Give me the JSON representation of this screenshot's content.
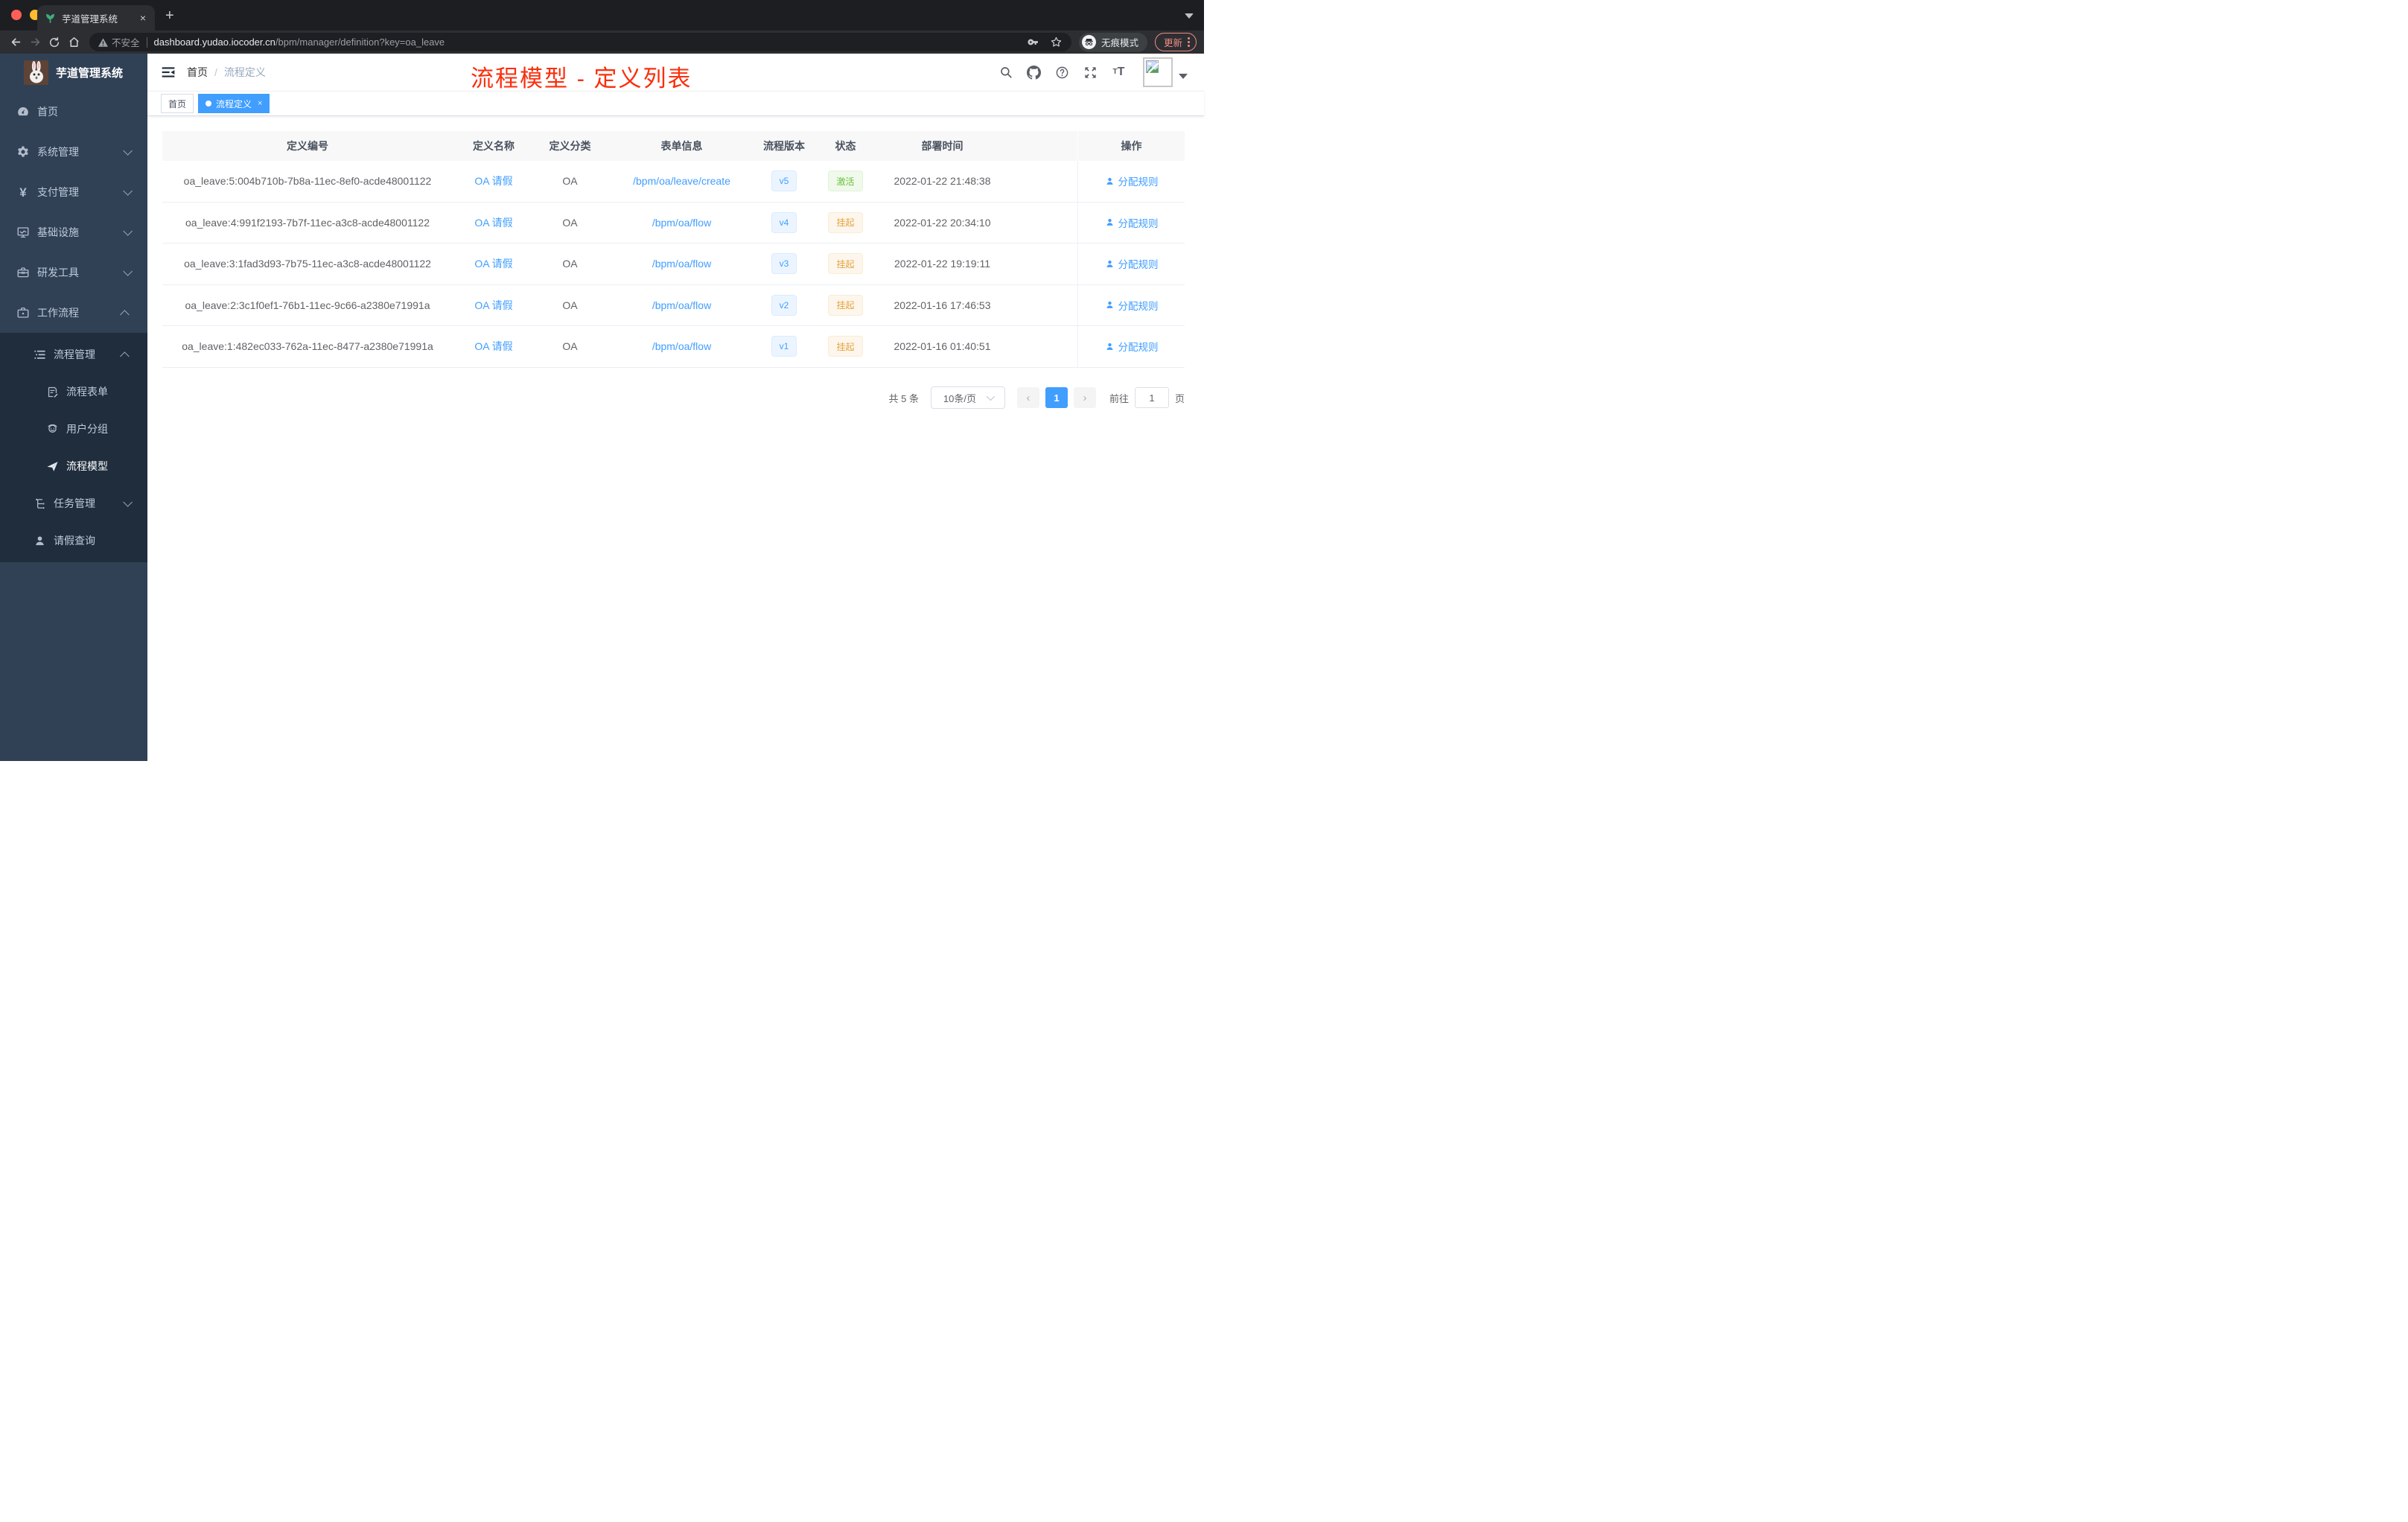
{
  "browser": {
    "tab_title": "芋道管理系统",
    "tab_close": "×",
    "new_tab": "+",
    "address": {
      "security_label": "不安全",
      "host": "dashboard.yudao.iocoder.cn",
      "path": "/bpm/manager/definition?key=oa_leave"
    },
    "incognito_label": "无痕模式",
    "update_label": "更新",
    "traffic_lights": [
      "#ff5f57",
      "#febc2e",
      "#2ac840"
    ]
  },
  "sidebar": {
    "logo_title": "芋道管理系统",
    "items": [
      {
        "icon": "dashboard-icon",
        "label": "首页"
      },
      {
        "icon": "gear-icon",
        "label": "系统管理",
        "chevron": "down"
      },
      {
        "icon": "yen-icon",
        "label": "支付管理",
        "chevron": "down"
      },
      {
        "icon": "monitor-icon",
        "label": "基础设施",
        "chevron": "down"
      },
      {
        "icon": "toolbox-icon",
        "label": "研发工具",
        "chevron": "down"
      },
      {
        "icon": "suitcase-icon",
        "label": "工作流程",
        "chevron": "up"
      }
    ],
    "workflow_menu": [
      {
        "icon": "list-icon",
        "label": "流程管理",
        "chevron": "up"
      },
      {
        "icon": "form-icon",
        "label": "流程表单"
      },
      {
        "icon": "people-icon",
        "label": "用户分组"
      },
      {
        "icon": "paper-plane-icon",
        "label": "流程模型",
        "active": true
      },
      {
        "icon": "tree-icon",
        "label": "任务管理",
        "chevron": "down"
      },
      {
        "icon": "user-icon",
        "label": "请假查询"
      }
    ]
  },
  "navbar": {
    "breadcrumb": {
      "home": "首页",
      "separator": "/",
      "current": "流程定义"
    },
    "annotation": "流程模型 - 定义列表",
    "annotation_color": "#fb2e0c"
  },
  "tags": [
    {
      "label": "首页",
      "active": false
    },
    {
      "label": "流程定义",
      "active": true,
      "close": "×"
    }
  ],
  "table": {
    "headers": [
      "定义编号",
      "定义名称",
      "定义分类",
      "表单信息",
      "流程版本",
      "状态",
      "部署时间",
      "操作"
    ],
    "rows": [
      {
        "id": "oa_leave:5:004b710b-7b8a-11ec-8ef0-acde48001122",
        "name": "OA 请假",
        "category": "OA",
        "form": "/bpm/oa/leave/create",
        "version": "v5",
        "status": "激活",
        "status_type": "active",
        "deploy_time": "2022-01-22 21:48:38",
        "action": "分配规则"
      },
      {
        "id": "oa_leave:4:991f2193-7b7f-11ec-a3c8-acde48001122",
        "name": "OA 请假",
        "category": "OA",
        "form": "/bpm/oa/flow",
        "version": "v4",
        "status": "挂起",
        "status_type": "suspended",
        "deploy_time": "2022-01-22 20:34:10",
        "action": "分配规则"
      },
      {
        "id": "oa_leave:3:1fad3d93-7b75-11ec-a3c8-acde48001122",
        "name": "OA 请假",
        "category": "OA",
        "form": "/bpm/oa/flow",
        "version": "v3",
        "status": "挂起",
        "status_type": "suspended",
        "deploy_time": "2022-01-22 19:19:11",
        "action": "分配规则"
      },
      {
        "id": "oa_leave:2:3c1f0ef1-76b1-11ec-9c66-a2380e71991a",
        "name": "OA 请假",
        "category": "OA",
        "form": "/bpm/oa/flow",
        "version": "v2",
        "status": "挂起",
        "status_type": "suspended",
        "deploy_time": "2022-01-16 17:46:53",
        "action": "分配规则"
      },
      {
        "id": "oa_leave:1:482ec033-762a-11ec-8477-a2380e71991a",
        "name": "OA 请假",
        "category": "OA",
        "form": "/bpm/oa/flow",
        "version": "v1",
        "status": "挂起",
        "status_type": "suspended",
        "deploy_time": "2022-01-16 01:40:51",
        "action": "分配规则"
      }
    ]
  },
  "pagination": {
    "total_label": "共 5 条",
    "page_size": "10条/页",
    "prev": "‹",
    "current_page": "1",
    "next": "›",
    "goto_label": "前往",
    "goto_value": "1",
    "page_suffix": "页"
  },
  "colors": {
    "accent_blue": "#409eff",
    "success_green": "#67c23a",
    "warning_orange": "#e6a23c",
    "sidebar_bg": "#304156",
    "submenu_bg": "#1f2d3d"
  }
}
